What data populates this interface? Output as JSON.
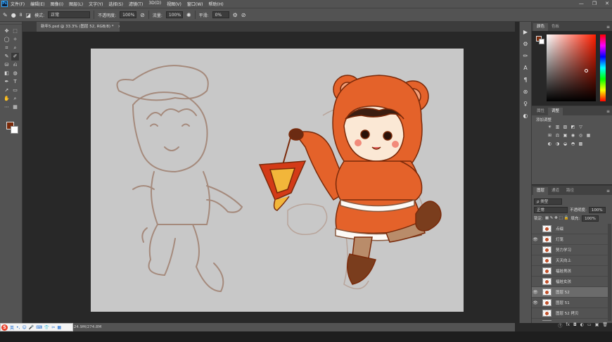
{
  "app": {
    "logo_text": "Ps",
    "menu": [
      "文件(F)",
      "编辑(E)",
      "图像(I)",
      "图层(L)",
      "文字(Y)",
      "选择(S)",
      "滤镜(T)",
      "3D(D)",
      "视图(V)",
      "窗口(W)",
      "帮助(H)"
    ],
    "window_controls": [
      "—",
      "❐",
      "✕"
    ]
  },
  "options": {
    "brush_size": "8",
    "mode_label": "模式:",
    "mode_value": "正常",
    "opacity_label": "不透明度:",
    "opacity_value": "100%",
    "flow_label": "流量:",
    "flow_value": "100%",
    "smoothing_label": "平滑:",
    "smoothing_value": "0%"
  },
  "document": {
    "tab_title": "新年5.psd @ 33.3% (图层 52, RGB/8) *",
    "close": "×"
  },
  "status": {
    "info": "文档:24.9M/274.8M"
  },
  "ime": {
    "logo": "S",
    "items": [
      "英",
      "•,",
      "☺",
      "🎤",
      "⌨",
      "👕",
      "✂",
      "▦"
    ]
  },
  "panels": {
    "color": {
      "tabs": [
        "颜色",
        "色板"
      ],
      "menu": "≡",
      "fg": "#7a2a0a",
      "bg": "#ffffff"
    },
    "adjustments": {
      "tabs": [
        "属性",
        "调整"
      ],
      "title": "添加调整",
      "row1": [
        "☀",
        "▥",
        "▨",
        "◩",
        "▽"
      ],
      "row2": [
        "⊞",
        "⚖",
        "▣",
        "◉",
        "◎",
        "▦"
      ],
      "row3": [
        "◐",
        "◑",
        "◒",
        "◓",
        "▩"
      ]
    },
    "layers": {
      "tabs": [
        "图层",
        "通道",
        "路径"
      ],
      "filter_label": "ρ 类型",
      "blend": "正常",
      "opacity_label": "不透明度:",
      "opacity_value": "100%",
      "lock_label": "锁定:",
      "fill_label": "填充:",
      "fill_value": "100%",
      "items": [
        {
          "name": "点缀",
          "visible": false
        },
        {
          "name": "灯笼",
          "visible": true
        },
        {
          "name": "努力学习",
          "visible": false
        },
        {
          "name": "天天向上",
          "visible": false
        },
        {
          "name": "福娃男孩",
          "visible": false
        },
        {
          "name": "福娃女孩",
          "visible": false
        },
        {
          "name": "图层 52",
          "visible": true,
          "selected": true
        },
        {
          "name": "图层 51",
          "visible": true
        },
        {
          "name": "图层 52 拷贝",
          "visible": false
        },
        {
          "name": "图层 50",
          "visible": false
        }
      ],
      "footer": [
        "ⓕ",
        "fx",
        "◘",
        "◐",
        "▭",
        "▣",
        "🗑"
      ]
    }
  },
  "tools": [
    "✥",
    "⬚",
    "◯",
    "✧",
    "⌗",
    "⌕",
    "✎",
    "✐",
    "⛁",
    "⎌",
    "◧",
    "◍",
    "✒",
    "T",
    "➚",
    "▭",
    "✋",
    "⌕",
    "⋯",
    "▦"
  ],
  "right_strip": [
    "▶",
    "⚙",
    "✏",
    "A",
    "¶",
    "⊛",
    "♀",
    "◐"
  ]
}
